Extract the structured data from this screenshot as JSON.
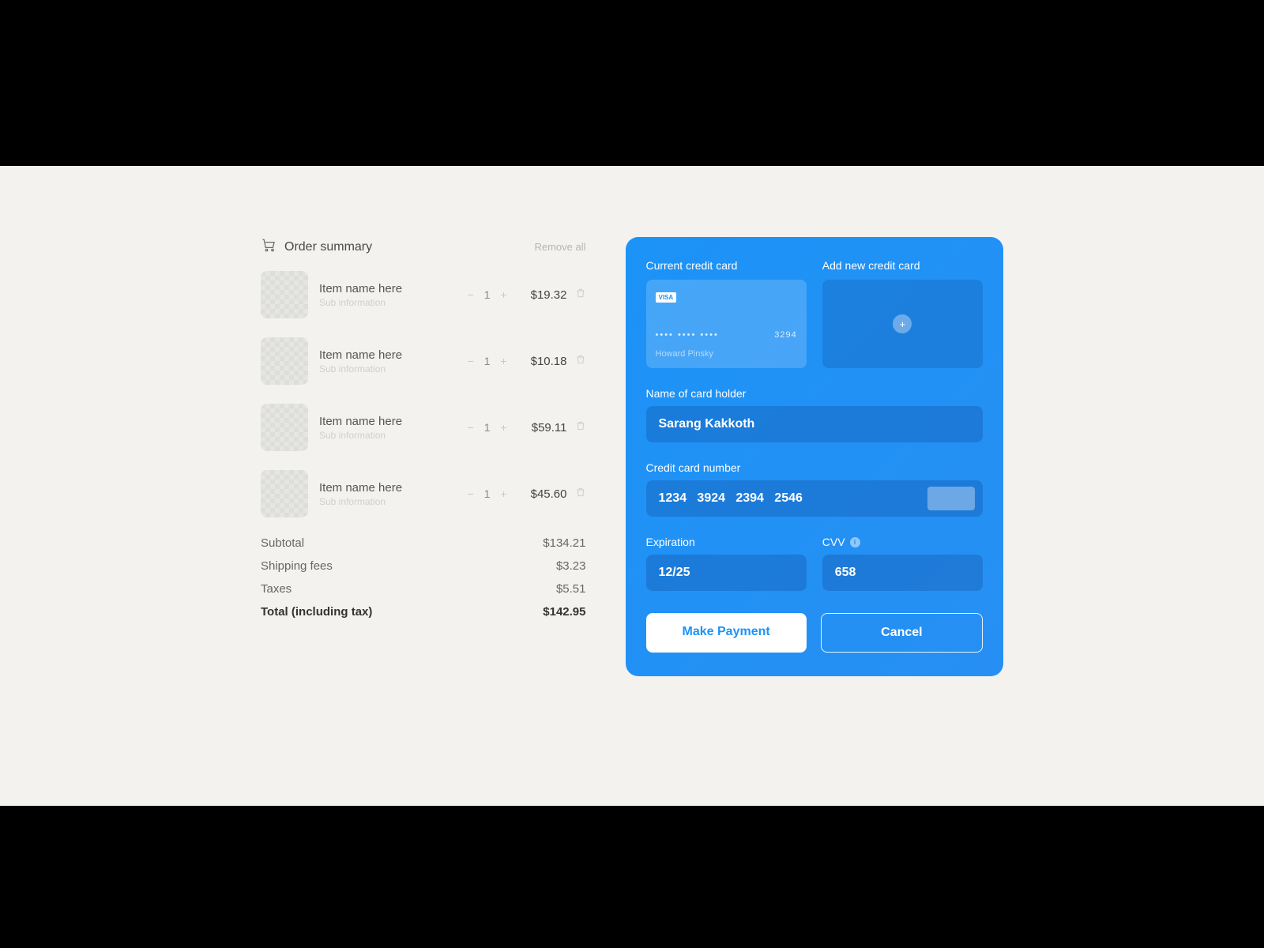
{
  "order_summary": {
    "title": "Order summary",
    "remove_all": "Remove all",
    "items": [
      {
        "name": "Item name here",
        "sub": "Sub information",
        "qty": "1",
        "price": "$19.32"
      },
      {
        "name": "Item name here",
        "sub": "Sub information",
        "qty": "1",
        "price": "$10.18"
      },
      {
        "name": "Item name here",
        "sub": "Sub information",
        "qty": "1",
        "price": "$59.11"
      },
      {
        "name": "Item name here",
        "sub": "Sub information",
        "qty": "1",
        "price": "$45.60"
      }
    ],
    "subtotal_label": "Subtotal",
    "subtotal": "$134.21",
    "shipping_label": "Shipping fees",
    "shipping": "$3.23",
    "taxes_label": "Taxes",
    "taxes": "$5.51",
    "total_label": "Total (including tax)",
    "total": "$142.95"
  },
  "payment": {
    "current_label": "Current credit card",
    "add_label": "Add new credit card",
    "card_brand": "VISA",
    "card_mask": "••••  ••••  ••••",
    "card_last4": "3294",
    "card_holder": "Howard Pinsky",
    "name_label": "Name of card holder",
    "name_value": "Sarang Kakkoth",
    "number_label": "Credit card number",
    "number_value": "1234   3924   2394   2546",
    "exp_label": "Expiration",
    "exp_value": "12/25",
    "cvv_label": "CVV",
    "cvv_value": "658",
    "make_payment": "Make Payment",
    "cancel": "Cancel"
  }
}
